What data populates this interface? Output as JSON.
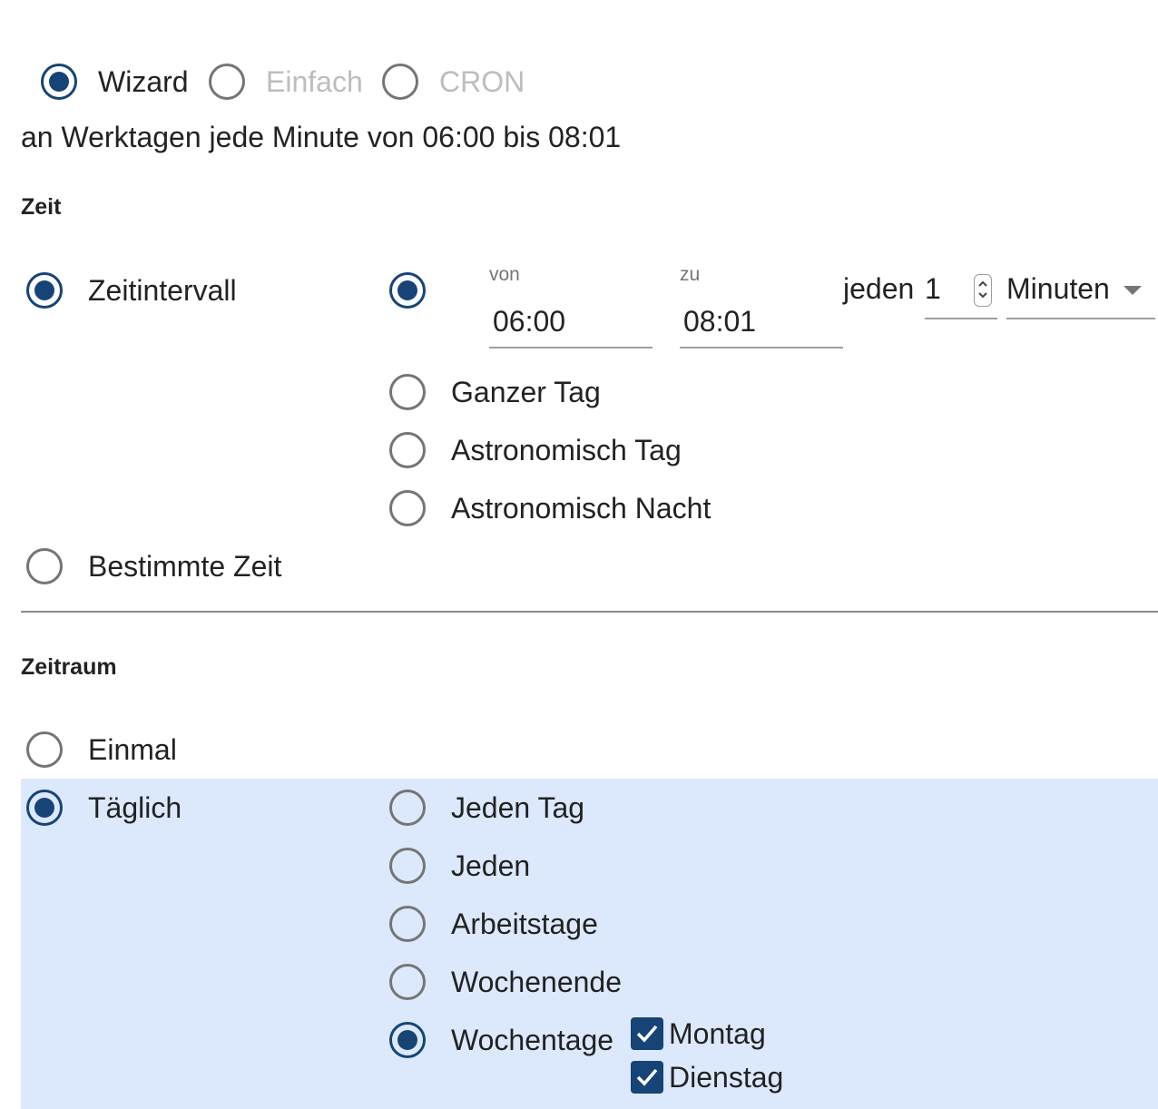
{
  "mode": {
    "options": [
      {
        "label": "Wizard",
        "checked": true,
        "disabled": false
      },
      {
        "label": "Einfach",
        "checked": false,
        "disabled": true
      },
      {
        "label": "CRON",
        "checked": false,
        "disabled": true
      }
    ]
  },
  "summary": "an Werktagen jede Minute von 06:00 bis 08:01",
  "zeit": {
    "title": "Zeit",
    "interval_label": "Zeitintervall",
    "specific_label": "Bestimmte Zeit",
    "from_label": "von",
    "from_value": "06:00",
    "to_label": "zu",
    "to_value": "08:01",
    "every_label": "jeden",
    "every_value": "1",
    "unit_value": "Minuten",
    "range_options": [
      "Ganzer Tag",
      "Astronomisch Tag",
      "Astronomisch Nacht"
    ]
  },
  "zeitraum": {
    "title": "Zeitraum",
    "once_label": "Einmal",
    "daily_label": "Täglich",
    "daily_options": [
      "Jeden Tag",
      "Jeden",
      "Arbeitstage",
      "Wochenende",
      "Wochentage"
    ],
    "weekdays": [
      {
        "label": "Montag",
        "checked": true
      },
      {
        "label": "Dienstag",
        "checked": true
      }
    ]
  },
  "colors": {
    "accent": "#164477",
    "highlight_bg": "#dce9fd",
    "disabled_text": "#bdbdbd"
  }
}
